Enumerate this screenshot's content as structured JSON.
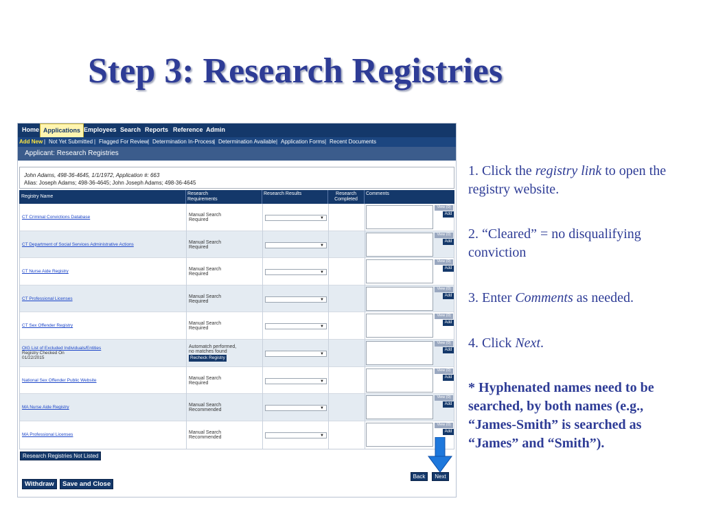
{
  "slide": {
    "title": "Step 3: Research Registries"
  },
  "app": {
    "nav": [
      "Home",
      "Applications",
      "Employees",
      "Search",
      "Reports",
      "Reference",
      "Admin"
    ],
    "active_nav": "Applications",
    "subnav": [
      "Add New",
      "Not Yet Submitted",
      "Flagged For Review",
      "Determination In-Process",
      "Determination Available",
      "Application Forms",
      "Recent Documents"
    ],
    "active_subnav": "Add New",
    "page_header": "Applicant: Research Registries",
    "applicant": {
      "line1": "John Adams, 498-36-4645, 1/1/1972, Application #: 663",
      "line2": "Alias: Joseph Adams; 498-36-4645; John Joseph Adams; 498-36-4645"
    },
    "columns": {
      "registry_name": "Registry Name",
      "requirements_1": "Research",
      "requirements_2": "Requirements",
      "results": "Research Results",
      "completed_1": "Research",
      "completed_2": "Completed",
      "comments": "Comments"
    },
    "rows": [
      {
        "name": "CT Criminal Convictions Database",
        "req1": "Manual Search",
        "req2": "Required"
      },
      {
        "name": "CT Department of Social Services Administrative Actions",
        "req1": "Manual Search",
        "req2": "Required"
      },
      {
        "name": "CT Nurse Aide Registry",
        "req1": "Manual Search",
        "req2": "Required"
      },
      {
        "name": "CT Professional Licenses",
        "req1": "Manual Search",
        "req2": "Required"
      },
      {
        "name": "CT Sex Offender Registry",
        "req1": "Manual Search",
        "req2": "Required"
      },
      {
        "name": "OIG List of Excluded Individuals/Entities",
        "note1": "Registry Checked On",
        "note2": "01/22/2015",
        "req1": "Automatch performed,",
        "req2": "no matches found",
        "button": "Recheck Registry"
      },
      {
        "name": "National Sex Offender Public Website",
        "req1": "Manual Search",
        "req2": "Required"
      },
      {
        "name": "MA Nurse Aide Registry",
        "req1": "Manual Search",
        "req2": "Recommended"
      },
      {
        "name": "MA Professional Licenses",
        "req1": "Manual Search",
        "req2": "Recommended"
      }
    ],
    "row_buttons": {
      "view": "View (0)",
      "add": "Add"
    },
    "select_caret": "▼",
    "buttons": {
      "not_listed": "Research Registries Not Listed",
      "back": "Back",
      "next": "Next",
      "withdraw": "Withdraw",
      "save_close": "Save and Close"
    }
  },
  "instructions": {
    "step1_a": "1. Click the ",
    "step1_em": "registry link",
    "step1_b": " to open the registry website.",
    "step2": "2. “Cleared” = no disqualifying conviction",
    "step3_a": "3. Enter ",
    "step3_em": "Comments",
    "step3_b": " as needed.",
    "step4_a": "4. Click ",
    "step4_em": "Next",
    "step4_b": ".",
    "note": "* Hyphenated names need to be searched, by both names (e.g., “James-Smith” is searched as “James” and “Smith”)."
  },
  "colors": {
    "title": "#2e3c96",
    "nav_bg": "#14386a",
    "active_tab": "#fff5b0",
    "add_new": "#ffe640",
    "link": "#1a44c8",
    "arrow": "#1e78dc"
  }
}
